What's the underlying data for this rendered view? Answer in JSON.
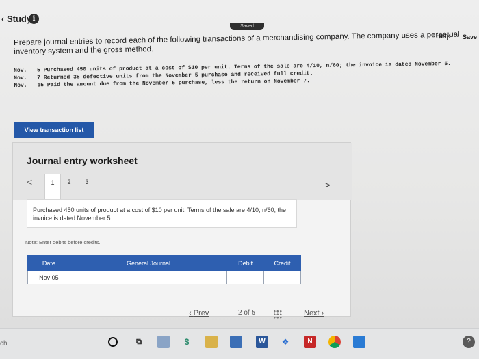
{
  "header": {
    "study_label": "Study",
    "info_icon_glyph": "i",
    "saved_label": "Saved",
    "help_label": "Help",
    "save_label": "Save"
  },
  "prompt": "Prepare journal entries to record each of the following transactions of a merchandising company. The company uses a perpetual inventory system and the gross method.",
  "transactions": [
    {
      "label": "Nov.",
      "text": "5 Purchased 450 units of product at a cost of $10 per unit. Terms of the sale are 4/10, n/60; the invoice is dated November 5."
    },
    {
      "label": "Nov.",
      "text": "7 Returned 35 defective units from the November 5 purchase and received full credit."
    },
    {
      "label": "Nov.",
      "text": "15 Paid the amount due from the November 5 purchase, less the return on November 7."
    }
  ],
  "view_button": "View transaction list",
  "worksheet": {
    "title": "Journal entry worksheet",
    "prev_icon": "<",
    "next_icon": ">",
    "tabs": [
      "1",
      "2",
      "3"
    ],
    "active_tab": "1",
    "description": "Purchased 450 units of product at a cost of $10 per unit. Terms of the sale are 4/10, n/60; the invoice is dated November 5.",
    "note": "Note: Enter debits before credits.",
    "columns": [
      "Date",
      "General Journal",
      "Debit",
      "Credit"
    ],
    "rows": [
      {
        "date": "Nov 05",
        "account": "",
        "debit": "",
        "credit": ""
      }
    ]
  },
  "pagination": {
    "prev_label": "Prev",
    "current": "2",
    "of_label": "of",
    "total": "5",
    "next_label": "Next"
  },
  "taskbar": {
    "search_stub": "ch",
    "icons": [
      "cortana-icon",
      "task-view-icon",
      "file-explorer-icon",
      "money-icon",
      "store-icon",
      "mail-icon",
      "word-icon",
      "dropbox-icon",
      "netflix-icon",
      "chrome-icon",
      "app-icon",
      "help-icon"
    ]
  },
  "colors": {
    "accent": "#2458a8",
    "table_header": "#2e5fb0",
    "netflix": "#c62828",
    "word": "#2b579a"
  }
}
